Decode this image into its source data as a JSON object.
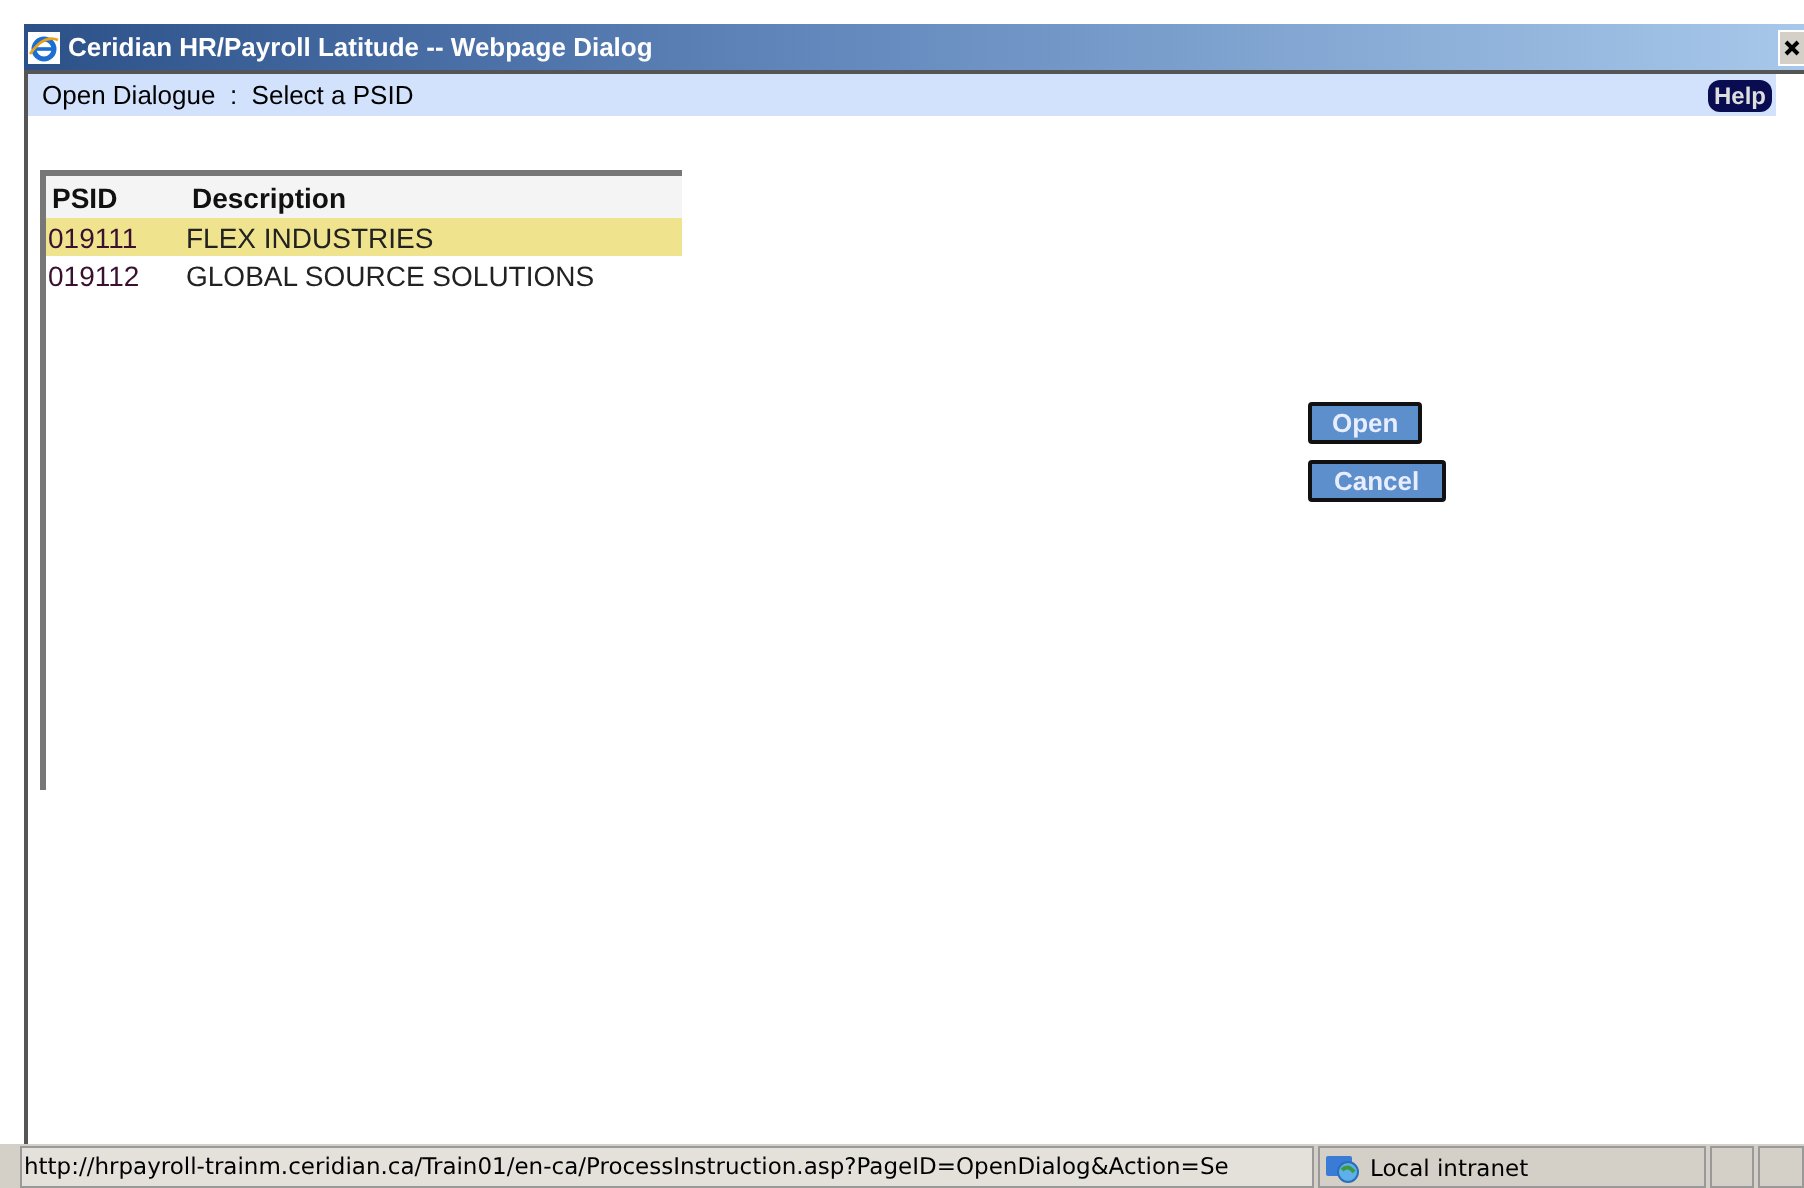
{
  "window": {
    "title": "Ceridian HR/Payroll Latitude -- Webpage Dialog"
  },
  "header": {
    "title": "Open Dialogue  :  Select a PSID",
    "help": "Help"
  },
  "table": {
    "columns": [
      "PSID",
      "Description"
    ],
    "rows": [
      {
        "cells": [
          "019111",
          "FLEX INDUSTRIES"
        ],
        "selected": true
      },
      {
        "cells": [
          "019112",
          "GLOBAL SOURCE SOLUTIONS"
        ],
        "selected": false
      }
    ]
  },
  "buttons": [
    "Open",
    "Cancel"
  ],
  "status_bar": {
    "url": "http://hrpayroll-trainm.ceridian.ca/Train01/en-ca/ProcessInstruction.asp?PageID=OpenDialog&Action=Se",
    "zone": "Local intranet"
  }
}
